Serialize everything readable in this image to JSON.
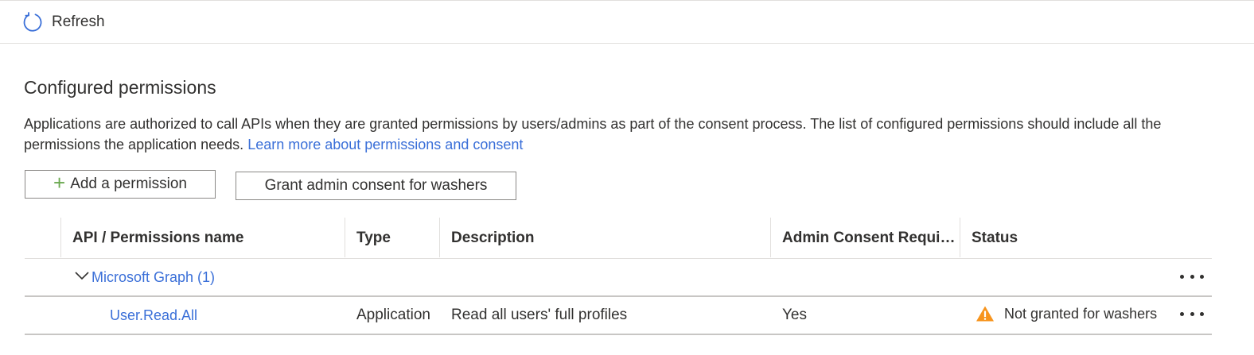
{
  "toolbar": {
    "refresh_label": "Refresh",
    "refresh_icon": "refresh-icon",
    "accent": "#3a6fd8"
  },
  "section": {
    "title": "Configured permissions",
    "description": "Applications are authorized to call APIs when they are granted permissions by users/admins as part of the consent process. The list of configured permissions should include all the permissions the application needs.",
    "learn_more_link": "Learn more about permissions and consent"
  },
  "actions": {
    "add_permission_label": "Add a permission",
    "add_icon": "plus-icon",
    "grant_consent_label": "Grant admin consent for washers"
  },
  "table": {
    "columns": [
      "API / Permissions name",
      "Type",
      "Description",
      "Admin Consent Requir...",
      "Status"
    ],
    "groups": [
      {
        "name": "Microsoft Graph (1)",
        "expanded": true,
        "permissions": [
          {
            "name": "User.Read.All",
            "type": "Application",
            "description": "Read all users' full profiles",
            "admin_consent_required": "Yes",
            "status": "Not granted for washers",
            "status_icon": "warning-icon",
            "status_color": "#f7941d"
          }
        ]
      }
    ]
  }
}
